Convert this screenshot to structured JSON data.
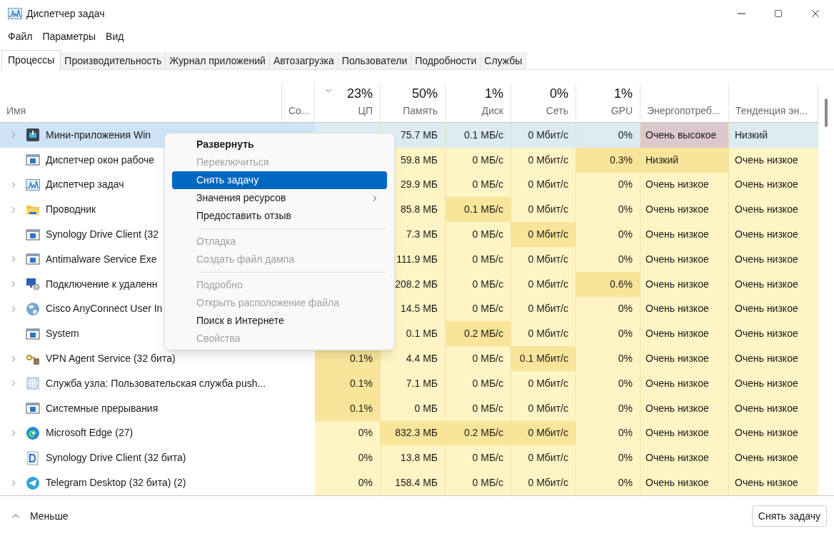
{
  "window": {
    "title": "Диспетчер задач"
  },
  "menu_bar": [
    "Файл",
    "Параметры",
    "Вид"
  ],
  "tabs": [
    {
      "label": "Процессы",
      "selected": true
    },
    {
      "label": "Производительность",
      "selected": false
    },
    {
      "label": "Журнал приложений",
      "selected": false
    },
    {
      "label": "Автозагрузка",
      "selected": false
    },
    {
      "label": "Пользователи",
      "selected": false
    },
    {
      "label": "Подробности",
      "selected": false
    },
    {
      "label": "Службы",
      "selected": false
    }
  ],
  "table": {
    "columns": [
      {
        "label": "Имя"
      },
      {
        "label": "Со..."
      },
      {
        "usage": "23%",
        "label": "ЦП",
        "sorted": true
      },
      {
        "usage": "50%",
        "label": "Память"
      },
      {
        "usage": "1%",
        "label": "Диск"
      },
      {
        "usage": "0%",
        "label": "Сеть"
      },
      {
        "usage": "1%",
        "label": "GPU"
      },
      {
        "label": "Энергопотреб..."
      },
      {
        "label": "Тенденция эн..."
      }
    ],
    "rows": [
      {
        "name": "Мини-приложения Win",
        "expandable": true,
        "selected": true,
        "memory": {
          "text": "75.7 МБ",
          "hot": false
        },
        "disk": {
          "text": "0.1 МБ/с",
          "hot": false
        },
        "network": {
          "text": "0 Мбит/с",
          "hot": false
        },
        "gpu": {
          "text": "0%",
          "hot": false
        },
        "energy": {
          "text": "Очень высокое",
          "hot": true
        },
        "trend": {
          "text": "Низкий",
          "hot": false
        }
      },
      {
        "name": "Диспетчер окон рабоче",
        "expandable": false,
        "selected": false,
        "memory": {
          "text": "59.8 МБ",
          "hot": false
        },
        "disk": {
          "text": "0 МБ/с",
          "hot": false
        },
        "network": {
          "text": "0 Мбит/с",
          "hot": false
        },
        "gpu": {
          "text": "0.3%",
          "hot": true
        },
        "energy": {
          "text": "Низкий",
          "hot": true
        },
        "trend": {
          "text": "Очень низкое",
          "hot": false
        }
      },
      {
        "name": "Диспетчер задач",
        "expandable": true,
        "selected": false,
        "memory": {
          "text": "29.9 МБ",
          "hot": false
        },
        "disk": {
          "text": "0 МБ/с",
          "hot": false
        },
        "network": {
          "text": "0 Мбит/с",
          "hot": false
        },
        "gpu": {
          "text": "0%",
          "hot": false
        },
        "energy": {
          "text": "Очень низкое",
          "hot": false
        },
        "trend": {
          "text": "Очень низкое",
          "hot": false
        }
      },
      {
        "name": "Проводник",
        "expandable": true,
        "selected": false,
        "memory": {
          "text": "85.8 МБ",
          "hot": false
        },
        "disk": {
          "text": "0.1 МБ/с",
          "hot": true
        },
        "network": {
          "text": "0 Мбит/с",
          "hot": false
        },
        "gpu": {
          "text": "0%",
          "hot": false
        },
        "energy": {
          "text": "Очень низкое",
          "hot": false
        },
        "trend": {
          "text": "Очень низкое",
          "hot": false
        }
      },
      {
        "name": "Synology Drive Client (32",
        "expandable": false,
        "selected": false,
        "memory": {
          "text": "7.3 МБ",
          "hot": false
        },
        "disk": {
          "text": "0 МБ/с",
          "hot": false
        },
        "network": {
          "text": "0 Мбит/с",
          "hot": true
        },
        "gpu": {
          "text": "0%",
          "hot": false
        },
        "energy": {
          "text": "Очень низкое",
          "hot": false
        },
        "trend": {
          "text": "Очень низкое",
          "hot": false
        }
      },
      {
        "name": "Antimalware Service Exe",
        "expandable": true,
        "selected": false,
        "memory": {
          "text": "111.9 МБ",
          "hot": false
        },
        "disk": {
          "text": "0 МБ/с",
          "hot": false
        },
        "network": {
          "text": "0 Мбит/с",
          "hot": false
        },
        "gpu": {
          "text": "0%",
          "hot": false
        },
        "energy": {
          "text": "Очень низкое",
          "hot": false
        },
        "trend": {
          "text": "Очень низкое",
          "hot": false
        }
      },
      {
        "name": "Подключение к удаленн",
        "expandable": true,
        "selected": false,
        "memory": {
          "text": "208.2 МБ",
          "hot": false
        },
        "disk": {
          "text": "0 МБ/с",
          "hot": false
        },
        "network": {
          "text": "0 Мбит/с",
          "hot": false
        },
        "gpu": {
          "text": "0.6%",
          "hot": true
        },
        "energy": {
          "text": "Очень низкое",
          "hot": false
        },
        "trend": {
          "text": "Очень низкое",
          "hot": false
        }
      },
      {
        "name": "Cisco AnyConnect User In",
        "expandable": true,
        "selected": false,
        "memory": {
          "text": "14.5 МБ",
          "hot": false
        },
        "disk": {
          "text": "0 МБ/с",
          "hot": false
        },
        "network": {
          "text": "0 Мбит/с",
          "hot": false
        },
        "gpu": {
          "text": "0%",
          "hot": false
        },
        "energy": {
          "text": "Очень низкое",
          "hot": false
        },
        "trend": {
          "text": "Очень низкое",
          "hot": false
        }
      },
      {
        "name": "System",
        "expandable": false,
        "selected": false,
        "memory": {
          "text": "0.1 МБ",
          "hot": false
        },
        "disk": {
          "text": "0.2 МБ/с",
          "hot": true
        },
        "network": {
          "text": "0 Мбит/с",
          "hot": false
        },
        "gpu": {
          "text": "0%",
          "hot": false
        },
        "energy": {
          "text": "Очень низкое",
          "hot": false
        },
        "trend": {
          "text": "Очень низкое",
          "hot": false
        }
      },
      {
        "name": "VPN Agent Service (32 бита)",
        "expandable": true,
        "selected": false,
        "cpu": {
          "text": "0.1%",
          "hot": true
        },
        "memory": {
          "text": "4.4 МБ",
          "hot": false
        },
        "disk": {
          "text": "0 МБ/с",
          "hot": false
        },
        "network": {
          "text": "0.1 Мбит/с",
          "hot": true
        },
        "gpu": {
          "text": "0%",
          "hot": false
        },
        "energy": {
          "text": "Очень низкое",
          "hot": false
        },
        "trend": {
          "text": "Очень низкое",
          "hot": false
        }
      },
      {
        "name": "Служба узла: Пользовательская служба push...",
        "expandable": true,
        "selected": false,
        "cpu": {
          "text": "0.1%",
          "hot": true
        },
        "memory": {
          "text": "7.1 МБ",
          "hot": false
        },
        "disk": {
          "text": "0 МБ/с",
          "hot": false
        },
        "network": {
          "text": "0 Мбит/с",
          "hot": false
        },
        "gpu": {
          "text": "0%",
          "hot": false
        },
        "energy": {
          "text": "Очень низкое",
          "hot": false
        },
        "trend": {
          "text": "Очень низкое",
          "hot": false
        }
      },
      {
        "name": "Системные прерывания",
        "expandable": false,
        "selected": false,
        "cpu": {
          "text": "0.1%",
          "hot": true
        },
        "memory": {
          "text": "0 МБ",
          "hot": false
        },
        "disk": {
          "text": "0 МБ/с",
          "hot": false
        },
        "network": {
          "text": "0 Мбит/с",
          "hot": false
        },
        "gpu": {
          "text": "0%",
          "hot": false
        },
        "energy": {
          "text": "Очень низкое",
          "hot": false
        },
        "trend": {
          "text": "Очень низкое",
          "hot": false
        }
      },
      {
        "name": "Microsoft Edge (27)",
        "expandable": true,
        "selected": false,
        "cpu": {
          "text": "0%",
          "hot": false
        },
        "memory": {
          "text": "832.3 МБ",
          "hot": true
        },
        "disk": {
          "text": "0.2 МБ/с",
          "hot": true
        },
        "network": {
          "text": "0 Мбит/с",
          "hot": true
        },
        "gpu": {
          "text": "0%",
          "hot": false
        },
        "energy": {
          "text": "Очень низкое",
          "hot": false
        },
        "trend": {
          "text": "Очень низкое",
          "hot": false
        }
      },
      {
        "name": "Synology Drive Client (32 бита)",
        "expandable": false,
        "selected": false,
        "cpu": {
          "text": "0%",
          "hot": false
        },
        "memory": {
          "text": "13.8 МБ",
          "hot": false
        },
        "disk": {
          "text": "0 МБ/с",
          "hot": false
        },
        "network": {
          "text": "0 Мбит/с",
          "hot": false
        },
        "gpu": {
          "text": "0%",
          "hot": false
        },
        "energy": {
          "text": "Очень низкое",
          "hot": false
        },
        "trend": {
          "text": "Очень низкое",
          "hot": false
        }
      },
      {
        "name": "Telegram Desktop (32 бита) (2)",
        "expandable": true,
        "selected": false,
        "cpu": {
          "text": "0%",
          "hot": false
        },
        "memory": {
          "text": "158.4 МБ",
          "hot": false
        },
        "disk": {
          "text": "0 МБ/с",
          "hot": false
        },
        "network": {
          "text": "0 Мбит/с",
          "hot": false
        },
        "gpu": {
          "text": "0%",
          "hot": false
        },
        "energy": {
          "text": "Очень низкое",
          "hot": false
        },
        "trend": {
          "text": "Очень низкое",
          "hot": false
        }
      }
    ]
  },
  "context_menu": [
    {
      "kind": "item",
      "label": "Развернуть",
      "bold": true,
      "disabled": false,
      "selected": false,
      "submenu": false
    },
    {
      "kind": "item",
      "label": "Переключиться",
      "bold": false,
      "disabled": true,
      "selected": false,
      "submenu": false
    },
    {
      "kind": "item",
      "label": "Снять задачу",
      "bold": false,
      "disabled": false,
      "selected": true,
      "submenu": false
    },
    {
      "kind": "item",
      "label": "Значения ресурсов",
      "bold": false,
      "disabled": false,
      "selected": false,
      "submenu": true
    },
    {
      "kind": "item",
      "label": "Предоставить отзыв",
      "bold": false,
      "disabled": false,
      "selected": false,
      "submenu": false
    },
    {
      "kind": "separator"
    },
    {
      "kind": "item",
      "label": "Отладка",
      "bold": false,
      "disabled": true,
      "selected": false,
      "submenu": false
    },
    {
      "kind": "item",
      "label": "Создать файл дампа",
      "bold": false,
      "disabled": true,
      "selected": false,
      "submenu": false
    },
    {
      "kind": "separator"
    },
    {
      "kind": "item",
      "label": "Подробно",
      "bold": false,
      "disabled": true,
      "selected": false,
      "submenu": false
    },
    {
      "kind": "item",
      "label": "Открыть расположение файла",
      "bold": false,
      "disabled": true,
      "selected": false,
      "submenu": false
    },
    {
      "kind": "item",
      "label": "Поиск в Интернете",
      "bold": false,
      "disabled": false,
      "selected": false,
      "submenu": false
    },
    {
      "kind": "item",
      "label": "Свойства",
      "bold": false,
      "disabled": true,
      "selected": false,
      "submenu": false
    }
  ],
  "footer": {
    "toggle": "Меньше",
    "button": "Снять задачу"
  }
}
